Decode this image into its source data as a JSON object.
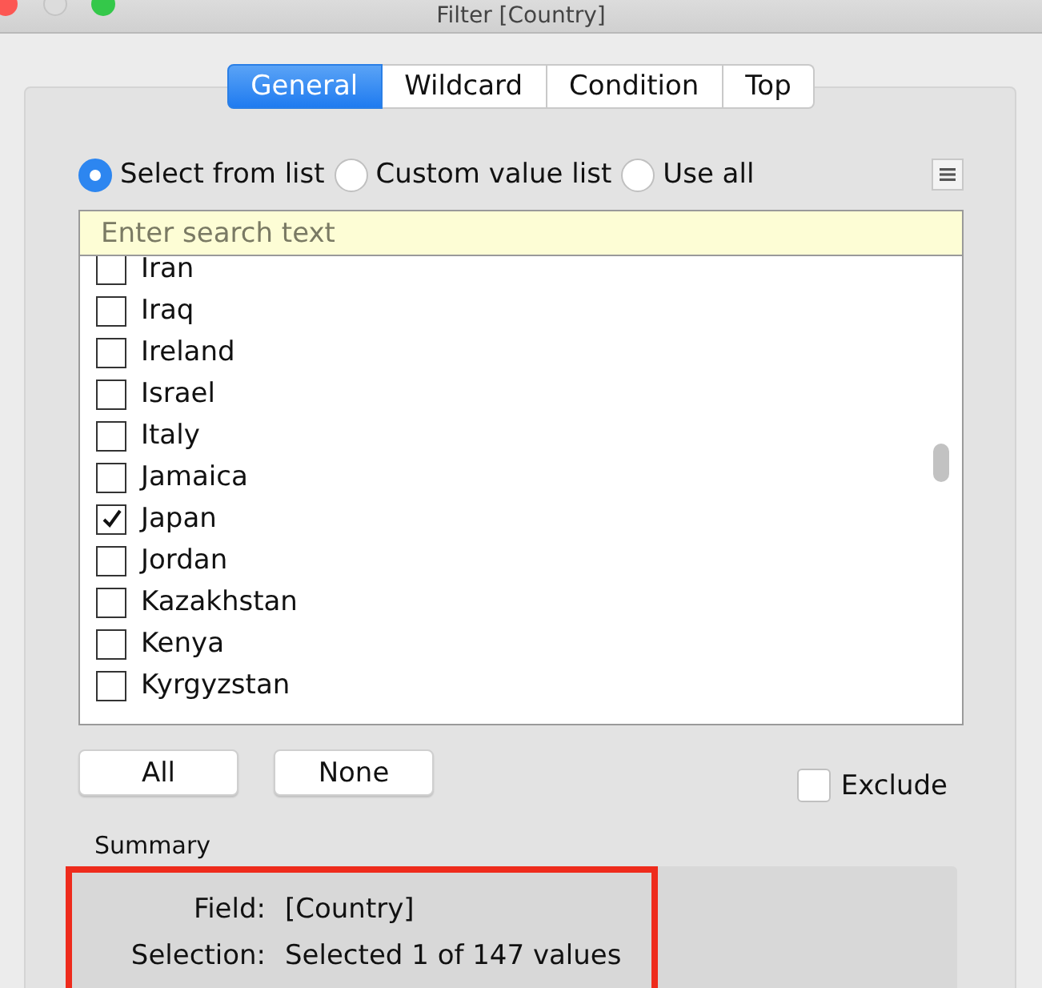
{
  "window": {
    "title": "Filter [Country]"
  },
  "tabs": [
    {
      "label": "General",
      "selected": true
    },
    {
      "label": "Wildcard",
      "selected": false
    },
    {
      "label": "Condition",
      "selected": false
    },
    {
      "label": "Top",
      "selected": false
    }
  ],
  "mode_options": [
    {
      "label": "Select from list",
      "selected": true
    },
    {
      "label": "Custom value list",
      "selected": false
    },
    {
      "label": "Use all",
      "selected": false
    }
  ],
  "search": {
    "placeholder": "Enter search text"
  },
  "values": [
    {
      "label": "Iran",
      "checked": false
    },
    {
      "label": "Iraq",
      "checked": false
    },
    {
      "label": "Ireland",
      "checked": false
    },
    {
      "label": "Israel",
      "checked": false
    },
    {
      "label": "Italy",
      "checked": false
    },
    {
      "label": "Jamaica",
      "checked": false
    },
    {
      "label": "Japan",
      "checked": true
    },
    {
      "label": "Jordan",
      "checked": false
    },
    {
      "label": "Kazakhstan",
      "checked": false
    },
    {
      "label": "Kenya",
      "checked": false
    },
    {
      "label": "Kyrgyzstan",
      "checked": false
    }
  ],
  "buttons": [
    "All",
    "None"
  ],
  "exclude": {
    "label": "Exclude",
    "checked": false
  },
  "summary": {
    "title": "Summary",
    "highlighted": true,
    "rows": [
      {
        "label": "Field:",
        "value": "[Country]"
      },
      {
        "label": "Selection:",
        "value": "Selected 1 of 147 values"
      }
    ]
  }
}
